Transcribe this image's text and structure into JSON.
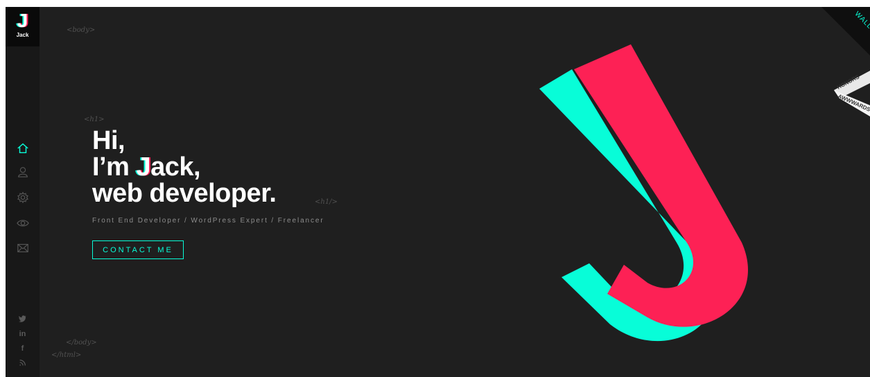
{
  "brand": {
    "logo_letter": "J",
    "logo_name": "Jack"
  },
  "code_tags": {
    "body_open": "<body>",
    "h1_open": "<h1>",
    "h1_close": "<h1/>",
    "body_close": "</body>",
    "html_close": "</html>"
  },
  "hero": {
    "line1": "Hi,",
    "line2_pre": "I’m ",
    "line2_j": "J",
    "line2_post": "ack,",
    "line3": "web developer.",
    "subtitle": "Front End Developer / WordPress Expert / Freelancer",
    "cta_label": "CONTACT ME"
  },
  "nav": {
    "items": [
      {
        "icon": "home-icon",
        "active": true
      },
      {
        "icon": "user-icon",
        "active": false
      },
      {
        "icon": "gear-icon",
        "active": false
      },
      {
        "icon": "eye-icon",
        "active": false
      },
      {
        "icon": "envelope-icon",
        "active": false
      }
    ]
  },
  "social": {
    "items": [
      {
        "icon": "twitter-icon"
      },
      {
        "icon": "linkedin-icon",
        "label": "in"
      },
      {
        "icon": "facebook-icon",
        "label": "f"
      },
      {
        "icon": "rss-icon"
      }
    ]
  },
  "corner_ribbon": {
    "text": "WALL"
  },
  "award_badge": {
    "line1": "HONORS",
    "line2": "AWWWARDS"
  },
  "colors": {
    "accent_cyan": "#08fdd8",
    "accent_red": "#fd2155",
    "background": "#1f1f1f",
    "sidebar": "#181818"
  }
}
